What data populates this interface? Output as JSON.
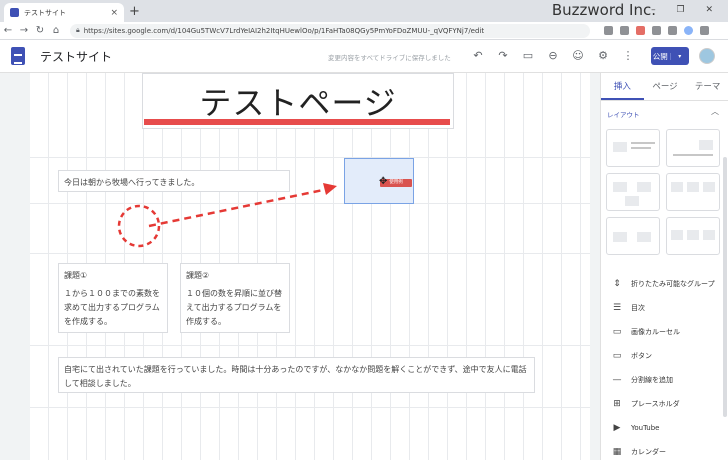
{
  "browser": {
    "tab_title": "テストサイト",
    "tab_close": "×",
    "new_tab": "+",
    "url": "https://sites.google.com/d/104Gu5TWcV7LrdYeIAI2h2ItqHUewlOo/p/1FaHTa08QGy5PmYoFDoZMUU-_qVQFYNj7/edit",
    "brand_overlay": "Buzzword Inc.",
    "window_controls": "– ❐ ✕"
  },
  "sites_header": {
    "site_name": "テストサイト",
    "save_status": "変更内容をすべてドライブに保存しました",
    "publish_label": "公開",
    "publish_dropdown": "▾"
  },
  "canvas": {
    "page_title": "テストページ",
    "text1": "今日は朝から牧場へ行ってきました。",
    "task1": {
      "heading": "課題①",
      "body": "１から１００までの素数を求めて出力するプログラムを作成する。"
    },
    "task2": {
      "heading": "課題②",
      "body": "１０個の数を昇順に並び替えて出力するプログラムを作成する。"
    },
    "text4": "自宅にて出されていた課題を行っていました。時間は十分あったのですが、なかなか問題を解くことができず、途中で友人に電話して相談しました。",
    "drag_chip": "使用例"
  },
  "panel": {
    "tabs": [
      "挿入",
      "ページ",
      "テーマ"
    ],
    "layout_section": "レイアウト",
    "items": [
      {
        "icon": "collapsible-icon",
        "glyph": "⇕",
        "label": "折りたたみ可能なグループ"
      },
      {
        "icon": "toc-icon",
        "glyph": "☰",
        "label": "目次"
      },
      {
        "icon": "carousel-icon",
        "glyph": "▭",
        "label": "画像カルーセル"
      },
      {
        "icon": "button-icon",
        "glyph": "▭",
        "label": "ボタン"
      },
      {
        "icon": "divider-icon",
        "glyph": "—",
        "label": "分割線を追加"
      },
      {
        "icon": "placeholder-icon",
        "glyph": "⊞",
        "label": "プレースホルダ"
      },
      {
        "icon": "youtube-icon",
        "glyph": "▶",
        "label": "YouTube"
      },
      {
        "icon": "calendar-icon",
        "glyph": "▦",
        "label": "カレンダー"
      }
    ]
  },
  "colors": {
    "accent": "#3f51b5",
    "annotation_red": "#e53935",
    "selection_fill": "#e3ecfa"
  }
}
